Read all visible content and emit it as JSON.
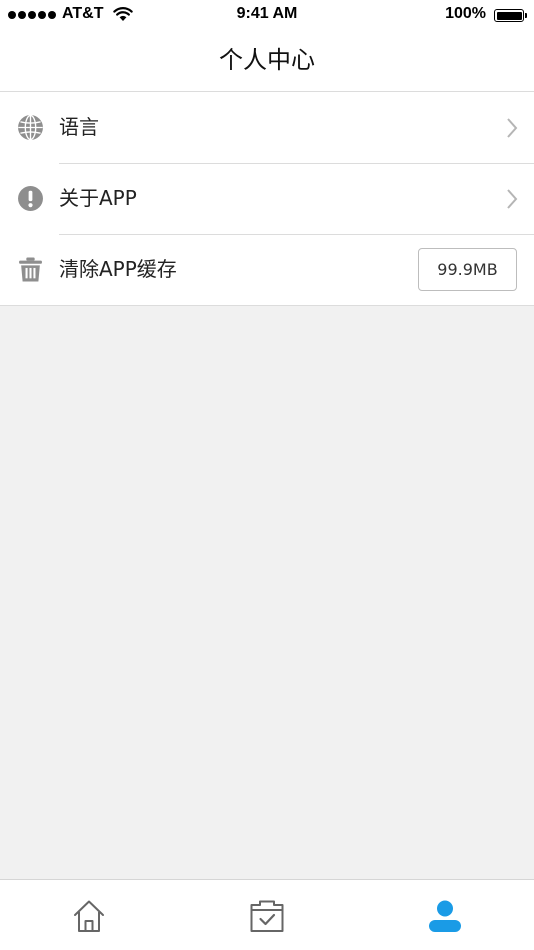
{
  "status_bar": {
    "carrier": "AT&T",
    "time": "9:41 AM",
    "battery_percent": "100%",
    "battery_level": 1.0,
    "signal_bars": 5
  },
  "nav": {
    "title": "个人中心"
  },
  "settings": {
    "items": [
      {
        "label": "语言",
        "icon": "globe-icon"
      },
      {
        "label": "关于APP",
        "icon": "info-exclamation-icon"
      },
      {
        "label": "清除APP缓存",
        "icon": "trash-icon",
        "value": "99.9MB"
      }
    ]
  },
  "tab_bar": {
    "tabs": [
      {
        "icon": "home-icon",
        "active": false
      },
      {
        "icon": "folder-check-icon",
        "active": false
      },
      {
        "icon": "user-icon",
        "active": true
      }
    ]
  },
  "colors": {
    "accent": "#1a9be6",
    "icon_gray": "#8e8e8e",
    "inactive_tab": "#666666",
    "background": "#f1f1f1",
    "divider": "#dcdcdc"
  }
}
